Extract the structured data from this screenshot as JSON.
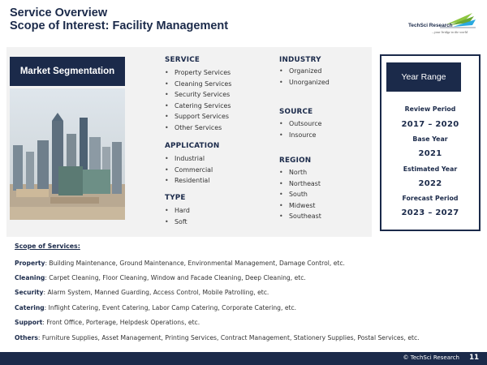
{
  "header": {
    "title_line1": "Service Overview",
    "title_line2": "Scope of Interest: Facility Management"
  },
  "logo": {
    "name": "TechSci Research",
    "tagline": "...your bridge to the world",
    "icon": "techsci-logo-mark"
  },
  "segmentation": {
    "title": "Market Segmentation",
    "image": "city-skyline-image",
    "service": {
      "heading": "SERVICE",
      "items": [
        "Property Services",
        "Cleaning Services",
        "Security Services",
        "Catering Services",
        "Support Services",
        "Other Services"
      ]
    },
    "application": {
      "heading": "APPLICATION",
      "items": [
        "Industrial",
        "Commercial",
        "Residential"
      ]
    },
    "type": {
      "heading": "TYPE",
      "items": [
        "Hard",
        "Soft"
      ]
    },
    "industry": {
      "heading": "INDUSTRY",
      "items": [
        "Organized",
        "Unorganized"
      ]
    },
    "source": {
      "heading": "SOURCE",
      "items": [
        "Outsource",
        "Insource"
      ]
    },
    "region": {
      "heading": "REGION",
      "items": [
        "North",
        "Northeast",
        "South",
        "Midwest",
        "Southeast"
      ]
    }
  },
  "year_range": {
    "title": "Year Range",
    "review_label": "Review Period",
    "review_value": "2017 – 2020",
    "base_label": "Base Year",
    "base_value": "2021",
    "estimated_label": "Estimated Year",
    "estimated_value": "2022",
    "forecast_label": "Forecast Period",
    "forecast_value": "2023 – 2027"
  },
  "scope": {
    "title": "Scope of Services:",
    "rows": [
      {
        "label": "Property",
        "text": ": Building Maintenance, Ground Maintenance, Environmental Management, Damage Control, etc."
      },
      {
        "label": "Cleaning",
        "text": ": Carpet Cleaning, Floor Cleaning, Window and Facade Cleaning, Deep Cleaning, etc."
      },
      {
        "label": "Security",
        "text": ": Alarm System, Manned Guarding, Access Control, Mobile Patrolling, etc."
      },
      {
        "label": "Catering",
        "text": ": Inflight Catering, Event Catering, Labor Camp Catering, Corporate Catering, etc."
      },
      {
        "label": "Support",
        "text": ": Front Office, Porterage, Helpdesk Operations, etc."
      },
      {
        "label": "Others",
        "text": ": Furniture Supplies, Asset Management, Printing Services, Contract Management, Stationery Supplies, Postal Services, etc."
      }
    ]
  },
  "footer": {
    "copyright": "© TechSci Research",
    "page_number": "11"
  },
  "colors": {
    "navy": "#1b2a4a",
    "panel_gray": "#f2f2f2",
    "logo_green": "#8dc63f",
    "logo_blue": "#29a9e0"
  }
}
